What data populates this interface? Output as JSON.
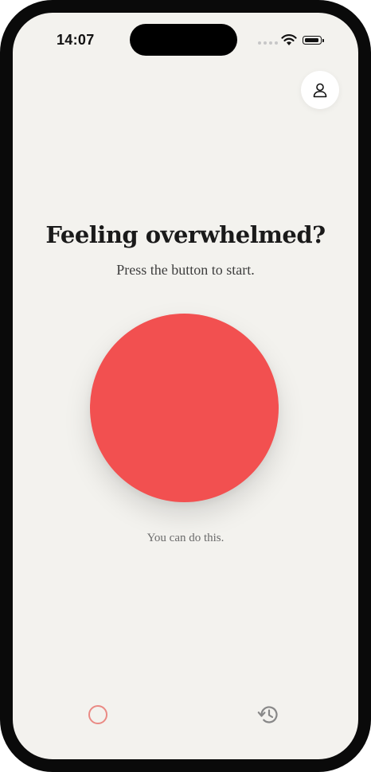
{
  "status_bar": {
    "time": "14:07"
  },
  "header": {
    "profile_icon": "person-icon"
  },
  "main": {
    "headline": "Feeling overwhelmed?",
    "subtitle": "Press the button to start.",
    "start_button_color": "#f25050",
    "encouragement": "You can do this."
  },
  "tab_bar": {
    "items": [
      {
        "icon": "circle-icon",
        "color": "#ea8a84"
      },
      {
        "icon": "history-icon",
        "color": "#888888"
      }
    ]
  },
  "colors": {
    "background": "#f3f2ee",
    "accent": "#f25050"
  }
}
